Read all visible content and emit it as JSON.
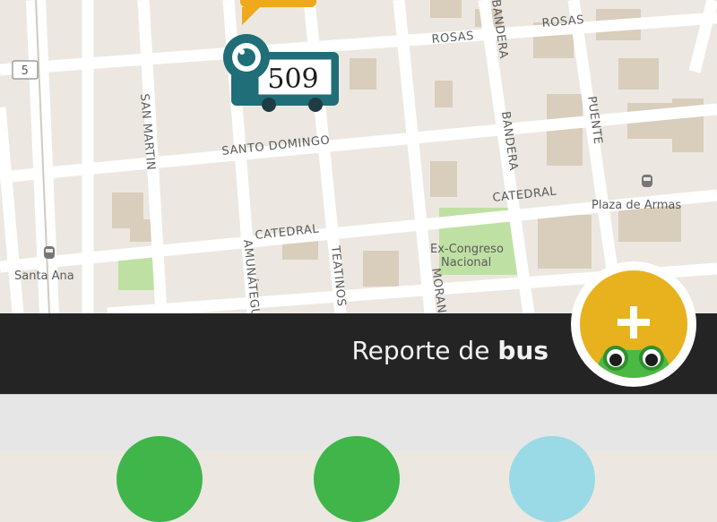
{
  "map": {
    "streets": {
      "rosas": "ROSAS",
      "bandera": "BANDERA",
      "san_martin": "SAN MARTIN",
      "santo_domingo": "SANTO DOMINGO",
      "catedral": "CATEDRAL",
      "amunategui": "AMUNÁTEGUI",
      "teatinos": "TEATINOS",
      "puente": "PUENTE",
      "morande": "MORANDÉ",
      "route_number": "5"
    },
    "pois": {
      "plaza_de_armas": "Plaza de Armas",
      "santa_ana": "Santa Ana",
      "ex_congreso_line1": "Ex-Congreso",
      "ex_congreso_line2": "Nacional"
    },
    "bus_marker": {
      "number": "509",
      "icon": "bus-icon"
    }
  },
  "report_bar": {
    "label_prefix": "Reporte de ",
    "label_bold": "bus"
  },
  "fab": {
    "icon": "plus-icon",
    "mascot": "frog-icon"
  },
  "colors": {
    "accent_yellow": "#e8b21f",
    "bus_teal": "#1f6e78",
    "bar_dark": "#242424",
    "tab_green": "#3fb54a",
    "tab_cyan": "#9ad9e6"
  }
}
